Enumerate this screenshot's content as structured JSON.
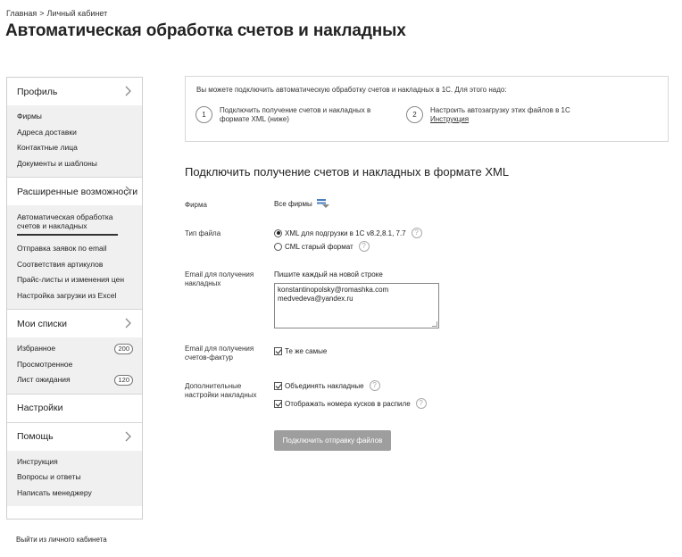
{
  "breadcrumb": {
    "home": "Главная",
    "separator": ">",
    "current": "Личный кабинет"
  },
  "page_title": "Автоматическая обработка счетов и накладных",
  "sidebar": {
    "sections": [
      {
        "title": "Профиль",
        "chevron": true,
        "items": [
          {
            "label": "Фирмы"
          },
          {
            "label": "Адреса доставки"
          },
          {
            "label": "Контактные лица"
          },
          {
            "label": "Документы и шаблоны"
          }
        ]
      },
      {
        "title": "Расширенные возможности",
        "chevron": true,
        "items": [
          {
            "label": "Автоматическая обработка счетов и накладных",
            "active": true
          },
          {
            "label": "Отправка заявок по email"
          },
          {
            "label": "Соответствия артикулов"
          },
          {
            "label": "Прайс-листы и изменения цен"
          },
          {
            "label": "Настройка загрузки из Excel"
          }
        ]
      },
      {
        "title": "Мои списки",
        "chevron": true,
        "items": [
          {
            "label": "Избранное",
            "badge": "200"
          },
          {
            "label": "Просмотренное"
          },
          {
            "label": "Лист ожидания",
            "badge": "120"
          }
        ]
      },
      {
        "title": "Настройки",
        "chevron": false,
        "items": []
      },
      {
        "title": "Помощь",
        "chevron": true,
        "items": [
          {
            "label": "Инструкция"
          },
          {
            "label": "Вопросы и ответы"
          },
          {
            "label": "Написать менеджеру"
          }
        ]
      }
    ],
    "logout": "Выйти из личного кабинета"
  },
  "info": {
    "intro": "Вы можете подключить автоматическую обработку счетов и накладных в 1С. Для этого надо:",
    "steps": [
      {
        "num": "1",
        "line1": "Подключить получение счетов и накладных в",
        "line2": "формате XML (ниже)"
      },
      {
        "num": "2",
        "line1": "Настроить автозагрузку этих файлов в 1С",
        "link": "Инструкция"
      }
    ]
  },
  "form": {
    "title": "Подключить получение счетов и накладных в формате XML",
    "firm": {
      "label": "Фирма",
      "value": "Все фирмы"
    },
    "file_type": {
      "label": "Тип файла",
      "options": [
        {
          "label": "XML для подгрузки в 1С v8.2,8.1, 7.7",
          "selected": true,
          "help": "?"
        },
        {
          "label": "CML старый формат",
          "selected": false,
          "help": "?"
        }
      ]
    },
    "email": {
      "label_line1": "Email для получения",
      "label_line2": "накладных",
      "hint": "Пишите каждый на новой строке",
      "values": [
        "konstantinopolsky@romashka.com",
        "medvedeva@yandex.ru"
      ]
    },
    "invoice_email": {
      "label_line1": "Email для получения",
      "label_line2": "счетов-фактур",
      "checkbox_label": "Те же самые",
      "checked": true
    },
    "extra": {
      "label_line1": "Дополнительные",
      "label_line2": "настройки накладных",
      "options": [
        {
          "label": "Объединять накладные",
          "checked": true,
          "help": "?"
        },
        {
          "label": "Отображать номера кусков в распиле",
          "checked": true,
          "help": "?"
        }
      ]
    },
    "submit_label": "Подключить отправку файлов"
  }
}
